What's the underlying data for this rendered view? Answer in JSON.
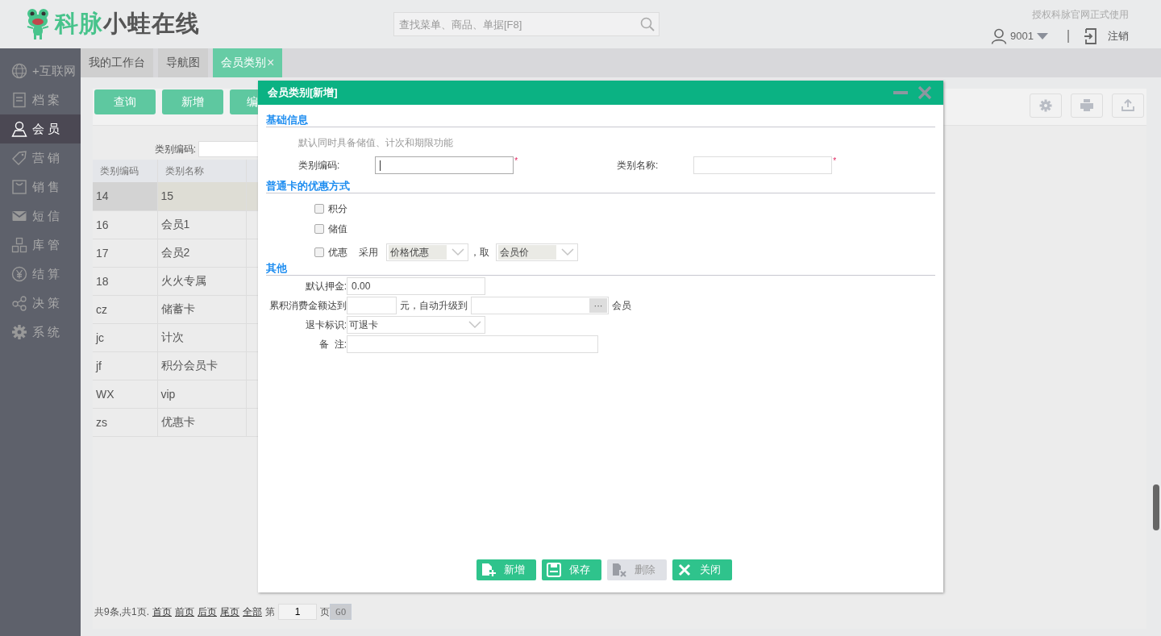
{
  "header": {
    "logo_brand": "科脉",
    "logo_name": "小蛙在线",
    "search": {
      "placeholder": "查找菜单、商品、单据[F8]"
    },
    "license_note": "授权科脉官网正式使用",
    "user": "9001",
    "logout": "注销"
  },
  "sidebar": {
    "items": [
      {
        "label": "+互联网",
        "kind": "globe",
        "selected": false
      },
      {
        "label": "档 案",
        "kind": "file",
        "selected": false
      },
      {
        "label": "会 员",
        "kind": "user",
        "selected": true
      },
      {
        "label": "营 销",
        "kind": "tag",
        "selected": false
      },
      {
        "label": "销 售",
        "kind": "bag",
        "selected": false
      },
      {
        "label": "短 信",
        "kind": "mail",
        "selected": false
      },
      {
        "label": "库 管",
        "kind": "org",
        "selected": false
      },
      {
        "label": "结 算",
        "kind": "yen",
        "selected": false
      },
      {
        "label": "决 策",
        "kind": "share",
        "selected": false
      },
      {
        "label": "系 统",
        "kind": "gear",
        "selected": false
      }
    ]
  },
  "tabs": [
    {
      "label": "我的工作台",
      "selected": false
    },
    {
      "label": "导航图",
      "selected": false
    },
    {
      "label": "会员类别",
      "selected": true,
      "close": "×"
    }
  ],
  "toolbar": {
    "buttons": [
      "查询",
      "新增",
      "编"
    ]
  },
  "filter": {
    "label": "类别编码:"
  },
  "table": {
    "columns": [
      "类别编码",
      "类别名称"
    ],
    "rows": [
      {
        "cells": [
          "14",
          "15"
        ],
        "selected": true
      },
      {
        "cells": [
          "16",
          "会员1"
        ],
        "selected": false
      },
      {
        "cells": [
          "17",
          "会员2"
        ],
        "selected": false
      },
      {
        "cells": [
          "18",
          "火火专属"
        ],
        "selected": false
      },
      {
        "cells": [
          "cz",
          "储蓄卡"
        ],
        "selected": false
      },
      {
        "cells": [
          "jc",
          "计次"
        ],
        "selected": false
      },
      {
        "cells": [
          "jf",
          "积分会员卡"
        ],
        "selected": false
      },
      {
        "cells": [
          "WX",
          "vip"
        ],
        "selected": false
      },
      {
        "cells": [
          "zs",
          "优惠卡"
        ],
        "selected": false
      }
    ]
  },
  "pager": {
    "summary": "共9条,共1页.",
    "links": [
      "首页",
      "前页",
      "后页",
      "尾页",
      "全部"
    ],
    "page_label": "第",
    "page": "1",
    "page_suffix": "页",
    "go": "GO"
  },
  "dialog": {
    "title": "会员类别[新增]",
    "basic": {
      "heading": "基础信息",
      "note": "默认同时具备储值、计次和期限功能",
      "fields": [
        {
          "label": "类别编码:",
          "mark": "*",
          "focused": true
        },
        {
          "label": "类别名称:",
          "mark": "*",
          "focused": false
        }
      ]
    },
    "discount": {
      "heading": "普通卡的优惠方式",
      "options": [
        {
          "label": "积分",
          "checked": false
        },
        {
          "label": "储值",
          "checked": false
        },
        {
          "label": "优惠",
          "checked": false
        }
      ],
      "use_label": "采用",
      "method": "价格优惠",
      "take_label": "，取",
      "price": "会员价"
    },
    "other": {
      "heading": "其他",
      "deposit_label": "默认押金:",
      "deposit": "0.00",
      "upgrade_label": "累积消费金额达到",
      "upgrade_mid": "元，自动升级到",
      "picker_button": "···",
      "member_suffix": "会员",
      "refund_label": "退卡标识:",
      "refund": "可退卡",
      "remark_label": "备  注:"
    },
    "buttons": [
      {
        "label": "新增",
        "kind": "add",
        "disabled": false
      },
      {
        "label": "保存",
        "kind": "save",
        "disabled": false
      },
      {
        "label": "删除",
        "kind": "delete",
        "disabled": true
      },
      {
        "label": "关闭",
        "kind": "close",
        "disabled": false
      }
    ]
  }
}
